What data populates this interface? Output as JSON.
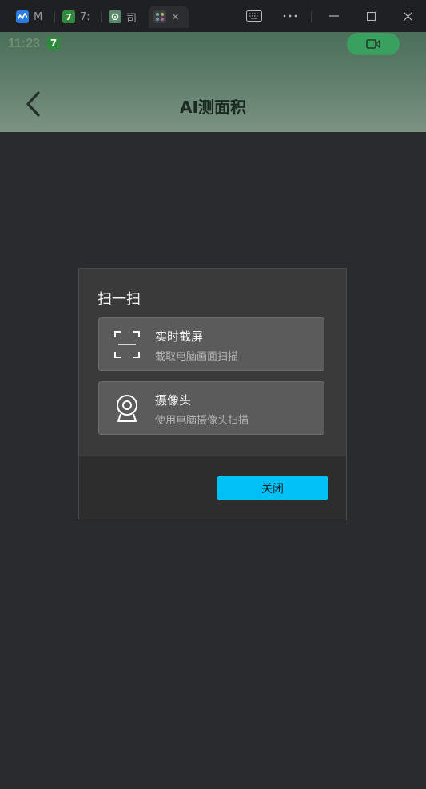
{
  "tabs": [
    {
      "label": "M",
      "icon": "chart-app-icon",
      "color": "#2b7de0"
    },
    {
      "label": "7",
      "icon": "seven-app-icon",
      "color": "#2f8a3c"
    },
    {
      "label": "司",
      "icon": "gear-app-icon",
      "color": "#5a8a6a"
    },
    {
      "label": "×",
      "icon": "grid-app-icon",
      "color": "#444"
    }
  ],
  "status": {
    "time": "11:23",
    "badge": "7"
  },
  "header": {
    "title": "AI测面积"
  },
  "dialog": {
    "title": "扫一扫",
    "options": [
      {
        "name": "实时截屏",
        "desc": "截取电脑画面扫描",
        "icon": "screen-capture-icon"
      },
      {
        "name": "摄像头",
        "desc": "使用电脑摄像头扫描",
        "icon": "webcam-icon"
      }
    ],
    "close_label": "关闭"
  },
  "colors": {
    "accent": "#00c0f5",
    "record": "#3aa060"
  }
}
